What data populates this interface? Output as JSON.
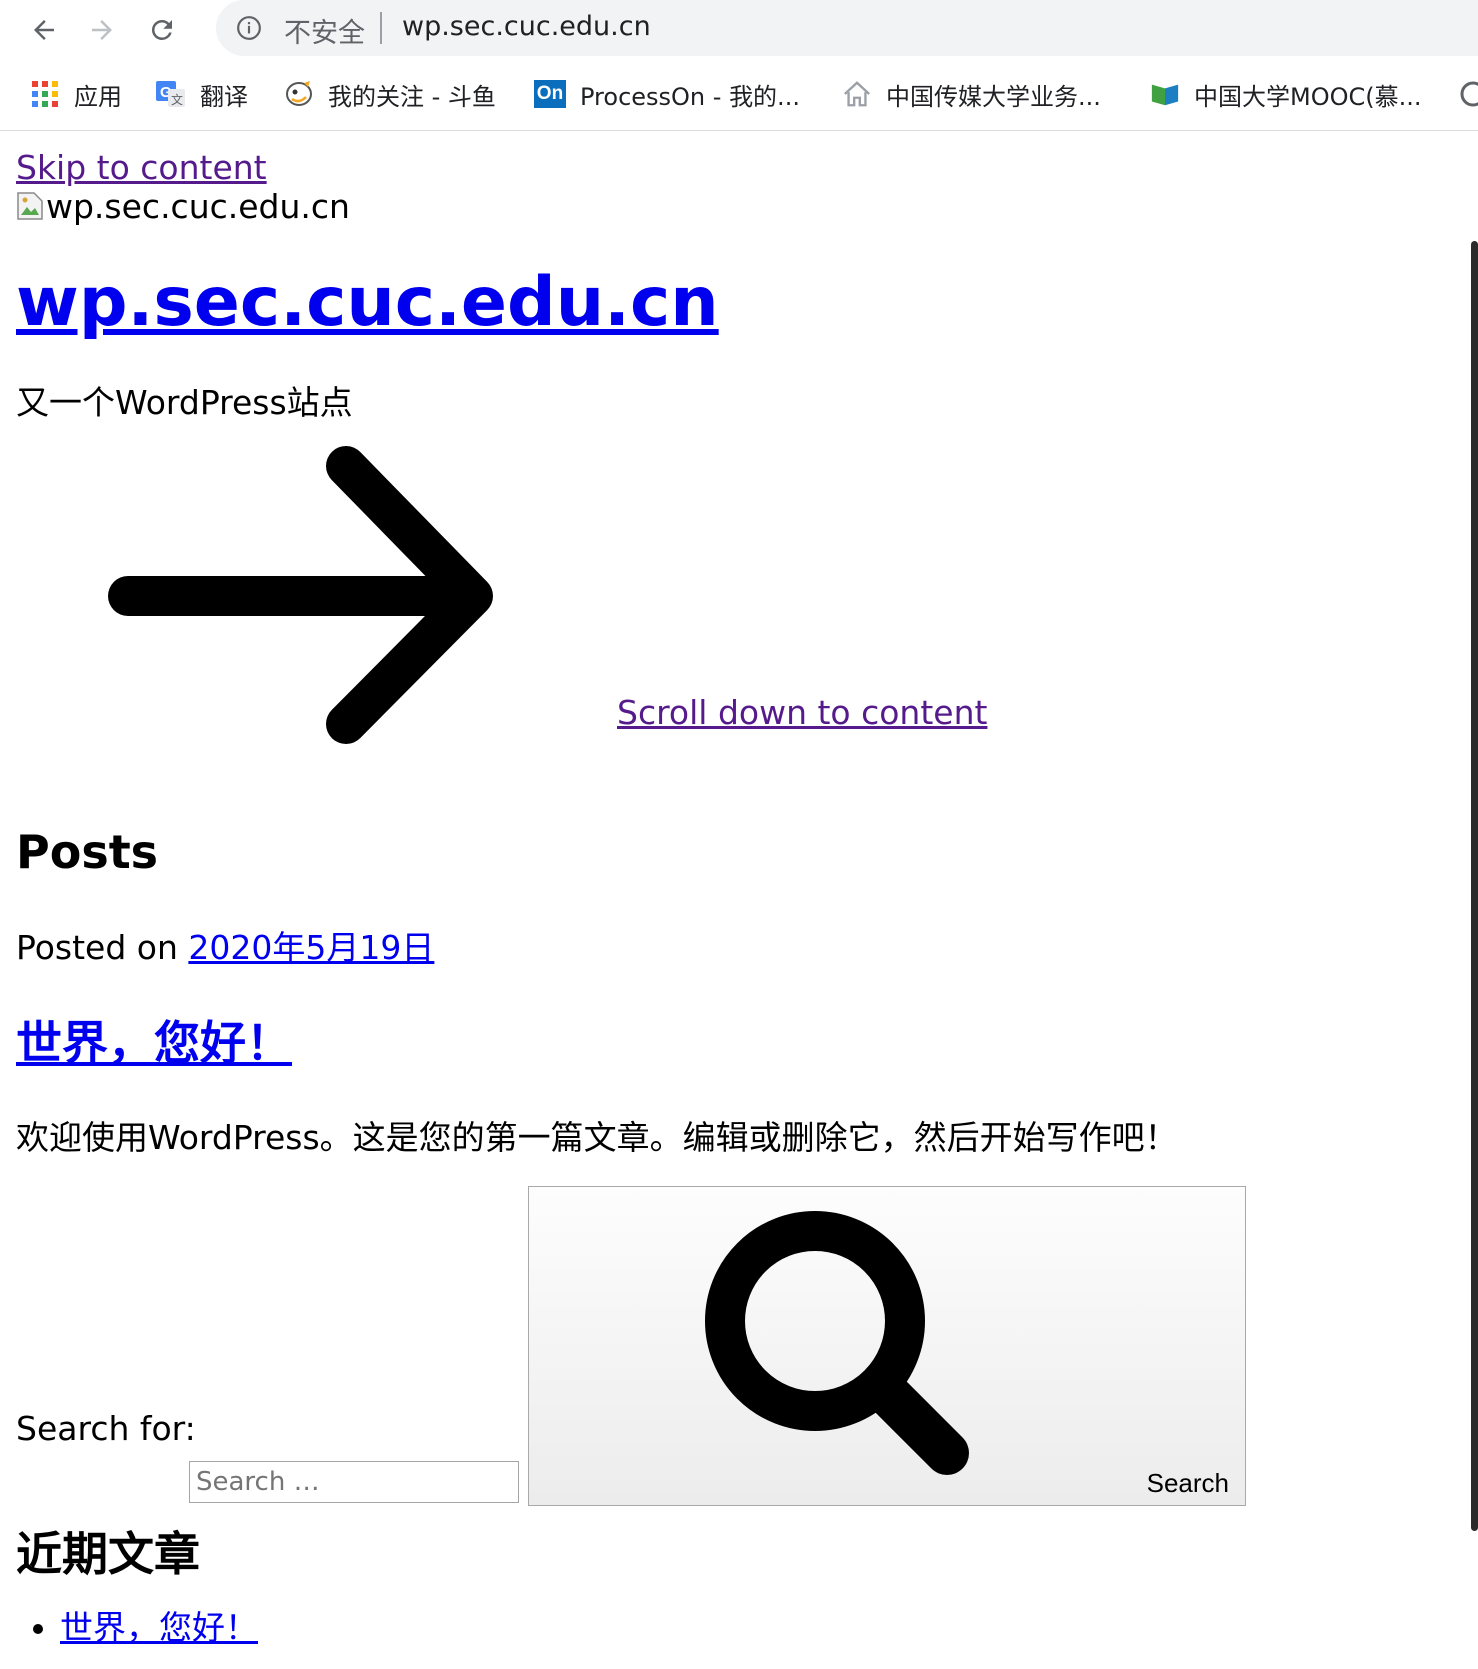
{
  "browser": {
    "security_label": "不安全",
    "url": "wp.sec.cuc.edu.cn",
    "bookmarks": [
      {
        "label": "应用",
        "icon": "apps-grid-icon"
      },
      {
        "label": "翻译",
        "icon": "google-translate-icon"
      },
      {
        "label": "我的关注 - 斗鱼",
        "icon": "douyu-icon"
      },
      {
        "label": "ProcessOn - 我的...",
        "icon": "processon-icon",
        "badge": "On"
      },
      {
        "label": "中国传媒大学业务...",
        "icon": "home-icon"
      },
      {
        "label": "中国大学MOOC(慕...",
        "icon": "mooc-icon"
      }
    ]
  },
  "page": {
    "skip_link": "Skip to content",
    "logo_alt": "wp.sec.cuc.edu.cn",
    "site_title": "wp.sec.cuc.edu.cn",
    "tagline": "又一个WordPress站点",
    "scroll_link": "Scroll down to content",
    "posts_heading": "Posts",
    "posted_on_label": "Posted on",
    "post_date": "2020年5月19日",
    "post_title": "世界，您好！",
    "post_excerpt": "欢迎使用WordPress。这是您的第一篇文章。编辑或删除它，然后开始写作吧！",
    "search": {
      "label": "Search for:",
      "placeholder": "Search …",
      "value": "",
      "button_label": "Search"
    },
    "recent_heading": "近期文章",
    "recent_posts": [
      "世界，您好！"
    ]
  }
}
